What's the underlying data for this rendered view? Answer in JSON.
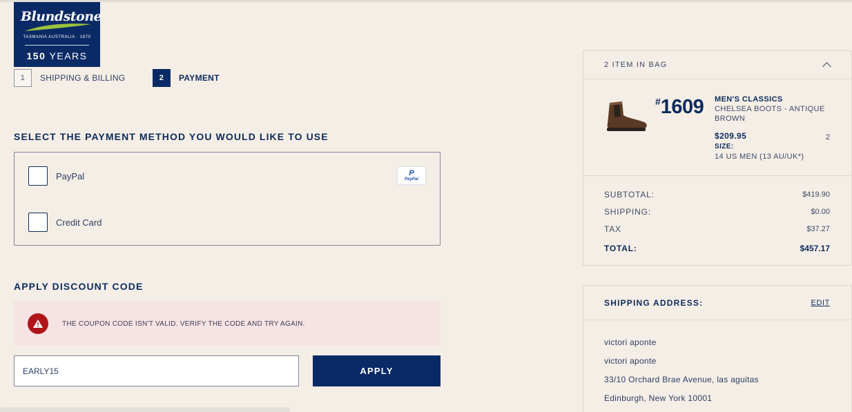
{
  "brand": {
    "name": "Blundstone",
    "tagline": "TASMANIA AUSTRALIA · 1870",
    "years_num": "150",
    "years_word": "YEARS"
  },
  "steps": [
    {
      "num": "1",
      "label": "SHIPPING & BILLING"
    },
    {
      "num": "2",
      "label": "PAYMENT"
    }
  ],
  "payment": {
    "title": "SELECT THE PAYMENT METHOD YOU WOULD LIKE TO USE",
    "options": [
      {
        "label": "PayPal"
      },
      {
        "label": "Credit Card"
      }
    ],
    "paypal_badge": {
      "p": "P",
      "text": "PayPal"
    }
  },
  "discount": {
    "title": "APPLY DISCOUNT CODE",
    "error": "THE COUPON CODE ISN'T VALID. VERIFY THE CODE AND TRY AGAIN.",
    "code": "EARLY15",
    "apply_label": "APPLY"
  },
  "summary": {
    "header": "2 ITEM IN BAG",
    "item": {
      "hash": "#",
      "model": "1609",
      "name": "MEN'S CLASSICS",
      "desc": "CHELSEA BOOTS - ANTIQUE BROWN",
      "price": "$209.95",
      "size_label": "SIZE:",
      "size": "14 US MEN (13 AU/UK*)",
      "qty": "2"
    },
    "totals": [
      {
        "label": "SUBTOTAL:",
        "value": "$419.90"
      },
      {
        "label": "SHIPPING:",
        "value": "$0.00"
      },
      {
        "label": "TAX",
        "value": "$37.27"
      }
    ],
    "grand_total": {
      "label": "TOTAL:",
      "value": "$457.17"
    }
  },
  "shipping_address": {
    "title": "SHIPPING ADDRESS:",
    "edit": "EDIT",
    "lines": [
      "victori aponte",
      "victori aponte",
      "33/10 Orchard Brae Avenue, las aguitas",
      "Edinburgh, New York 10001"
    ]
  },
  "colors": {
    "navy": "#0a2a66",
    "page_bg": "#f5eee6",
    "error_bg": "#f6e3e3",
    "error_icon": "#b01418"
  }
}
